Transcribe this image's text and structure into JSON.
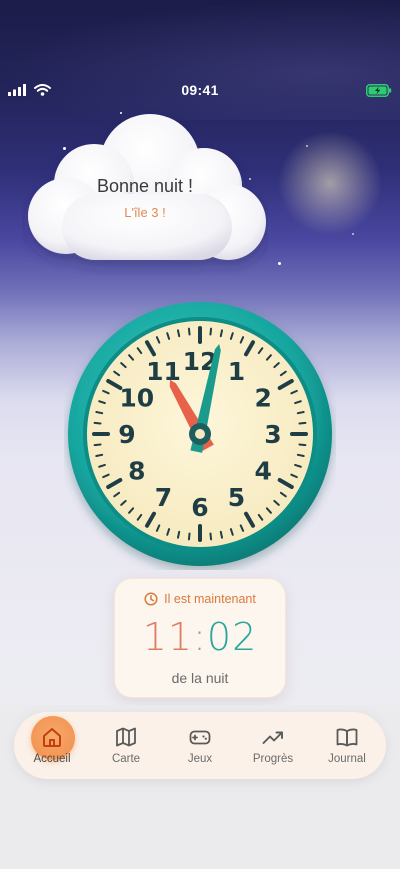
{
  "status_bar": {
    "time": "09:41",
    "icons": [
      "signal-icon",
      "wifi-icon",
      "battery-charging-icon"
    ]
  },
  "hero": {
    "greeting": "Bonne nuit !",
    "subtitle": "L'île 3 !"
  },
  "clock": {
    "numbers": [
      "12",
      "1",
      "2",
      "3",
      "4",
      "5",
      "6",
      "7",
      "8",
      "9",
      "10",
      "11"
    ],
    "hour": 11,
    "minute": 2,
    "colors": {
      "rim": "#1aa9a2",
      "face": "#fbf1cf",
      "hour_hand": "#e8624a",
      "minute_hand": "#1b9b8c",
      "digits": "#1f3d45"
    }
  },
  "time_card": {
    "label": "Il est maintenant",
    "hours": "11",
    "separator": ":",
    "minutes": "02",
    "period": "de la nuit"
  },
  "nav": {
    "active": "home",
    "items": [
      {
        "id": "home",
        "label": "Accueil",
        "icon": "home-icon"
      },
      {
        "id": "map",
        "label": "Carte",
        "icon": "map-icon"
      },
      {
        "id": "games",
        "label": "Jeux",
        "icon": "gamepad-icon"
      },
      {
        "id": "progress",
        "label": "Progrès",
        "icon": "trending-up-icon"
      },
      {
        "id": "journal",
        "label": "Journal",
        "icon": "book-icon"
      }
    ]
  },
  "colors": {
    "accent": "#f18d4a",
    "teal": "#2aa79a",
    "coral": "#e07c66"
  }
}
